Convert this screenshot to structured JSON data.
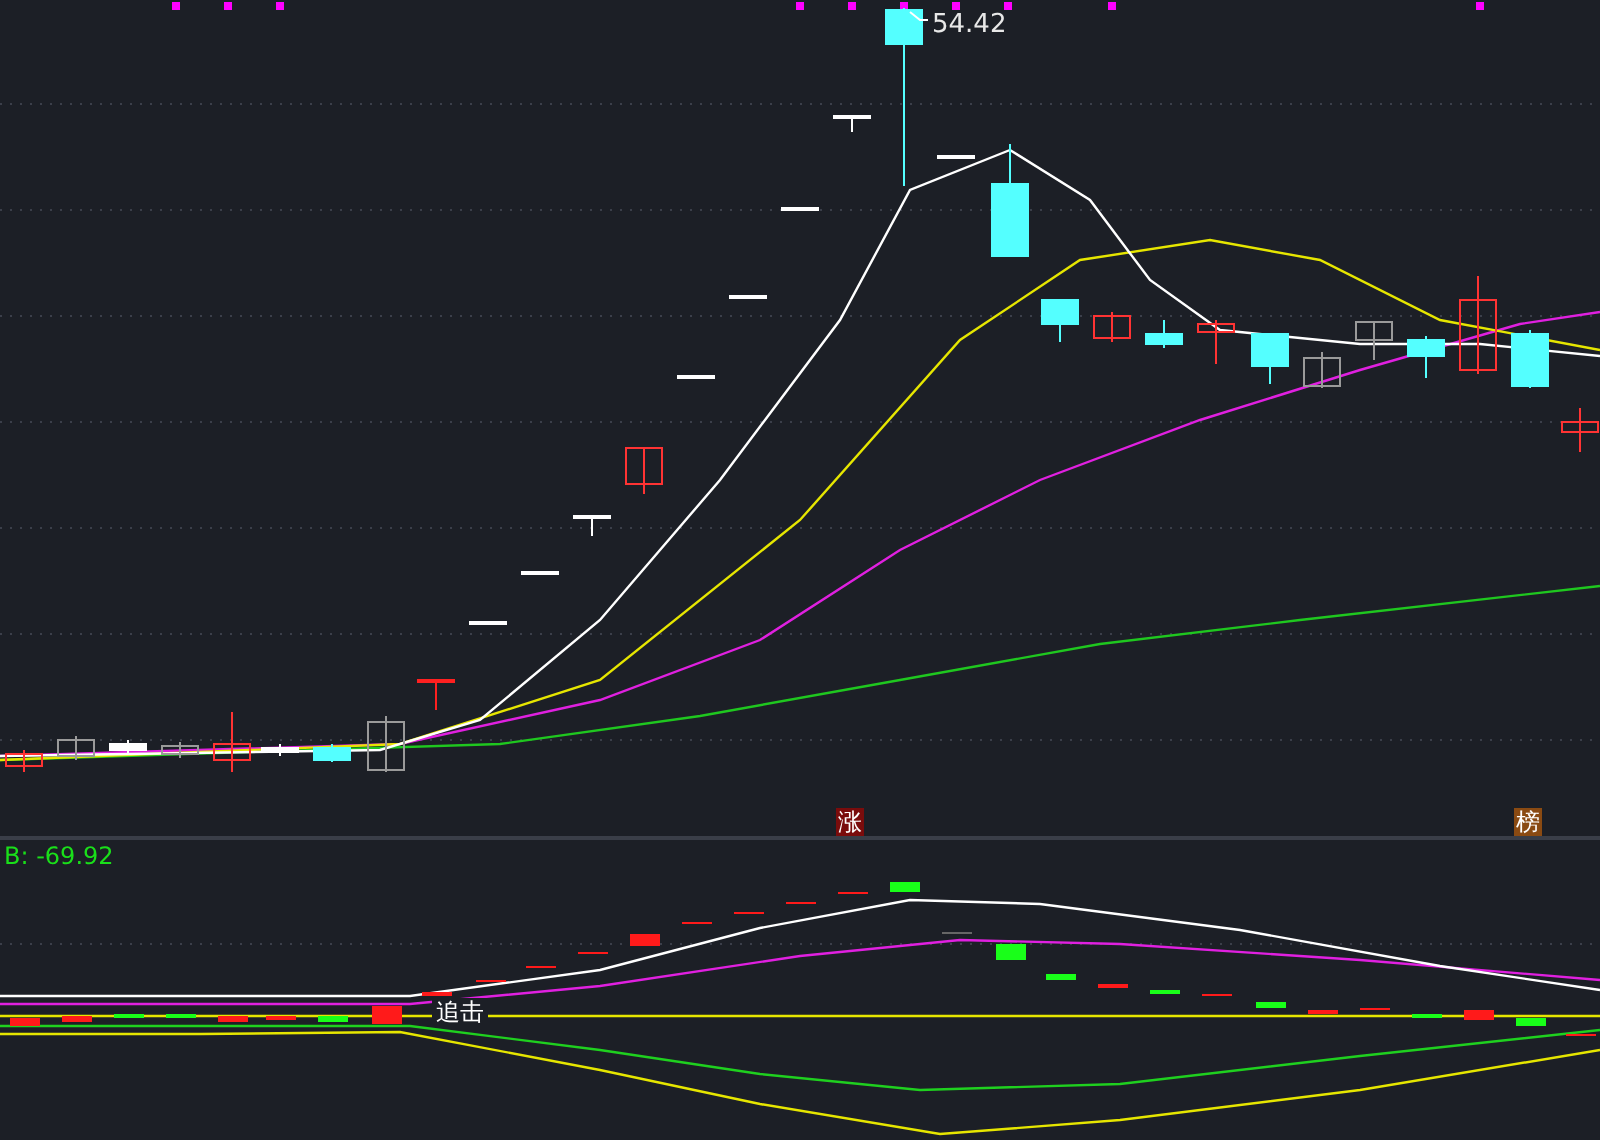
{
  "price_chart": {
    "high_label": "54.42",
    "markers": [
      {
        "text": "涨",
        "color": "#7a0c0c"
      },
      {
        "text": "榜",
        "color": "#8a4a12"
      }
    ]
  },
  "indicator_panel": {
    "reading": "B: -69.92",
    "signal_label": "追击"
  }
}
